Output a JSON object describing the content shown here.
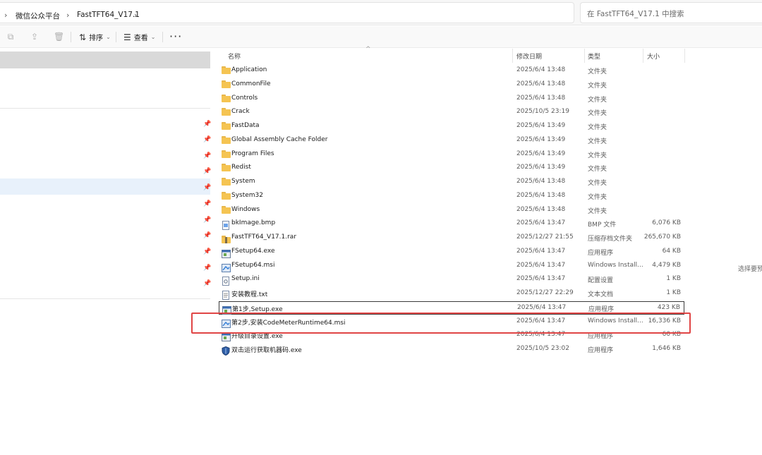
{
  "breadcrumb": [
    "微信公众平台",
    "FastTFT64_V17.1"
  ],
  "search_placeholder": "在 FastTFT64_V17.1 中搜索",
  "toolbar": {
    "sort_label": "排序",
    "view_label": "查看",
    "more_label": "···"
  },
  "columns": {
    "name": "名称",
    "modified": "修改日期",
    "type": "类型",
    "size": "大小"
  },
  "files": [
    {
      "name": "Application",
      "date": "2025/6/4 13:48",
      "type": "文件夹",
      "size": "",
      "icon": "folder-icon"
    },
    {
      "name": "CommonFile",
      "date": "2025/6/4 13:48",
      "type": "文件夹",
      "size": "",
      "icon": "folder-icon"
    },
    {
      "name": "Controls",
      "date": "2025/6/4 13:48",
      "type": "文件夹",
      "size": "",
      "icon": "folder-icon"
    },
    {
      "name": "Crack",
      "date": "2025/10/5 23:19",
      "type": "文件夹",
      "size": "",
      "icon": "folder-icon"
    },
    {
      "name": "FastData",
      "date": "2025/6/4 13:49",
      "type": "文件夹",
      "size": "",
      "icon": "folder-icon"
    },
    {
      "name": "Global Assembly Cache Folder",
      "date": "2025/6/4 13:49",
      "type": "文件夹",
      "size": "",
      "icon": "folder-icon"
    },
    {
      "name": "Program Files",
      "date": "2025/6/4 13:49",
      "type": "文件夹",
      "size": "",
      "icon": "folder-icon"
    },
    {
      "name": "Redist",
      "date": "2025/6/4 13:49",
      "type": "文件夹",
      "size": "",
      "icon": "folder-icon"
    },
    {
      "name": "System",
      "date": "2025/6/4 13:48",
      "type": "文件夹",
      "size": "",
      "icon": "folder-icon"
    },
    {
      "name": "System32",
      "date": "2025/6/4 13:48",
      "type": "文件夹",
      "size": "",
      "icon": "folder-icon"
    },
    {
      "name": "Windows",
      "date": "2025/6/4 13:48",
      "type": "文件夹",
      "size": "",
      "icon": "folder-icon"
    },
    {
      "name": "bkImage.bmp",
      "date": "2025/6/4 13:47",
      "type": "BMP 文件",
      "size": "6,076 KB",
      "icon": "image-file-icon"
    },
    {
      "name": "FastTFT64_V17.1.rar",
      "date": "2025/12/27 21:55",
      "type": "压缩存档文件夹",
      "size": "265,670 KB",
      "icon": "archive-icon"
    },
    {
      "name": "FSetup64.exe",
      "date": "2025/6/4 13:47",
      "type": "应用程序",
      "size": "64 KB",
      "icon": "exe-icon"
    },
    {
      "name": "FSetup64.msi",
      "date": "2025/6/4 13:47",
      "type": "Windows Install...",
      "size": "4,479 KB",
      "icon": "msi-icon"
    },
    {
      "name": "Setup.ini",
      "date": "2025/6/4 13:47",
      "type": "配置设置",
      "size": "1 KB",
      "icon": "ini-icon"
    },
    {
      "name": "安装教程.txt",
      "date": "2025/12/27 22:29",
      "type": "文本文档",
      "size": "1 KB",
      "icon": "text-file-icon"
    },
    {
      "name": "第1步,Setup.exe",
      "date": "2025/6/4 13:47",
      "type": "应用程序",
      "size": "423 KB",
      "icon": "exe-icon"
    },
    {
      "name": "第2步,安装CodeMeterRuntime64.msi",
      "date": "2025/6/4 13:47",
      "type": "Windows Install...",
      "size": "16,336 KB",
      "icon": "msi-icon"
    },
    {
      "name": "升级目录设置.exe",
      "date": "2025/6/4 13:47",
      "type": "应用程序",
      "size": "60 KB",
      "icon": "exe-icon"
    },
    {
      "name": "双击运行获取机器码.exe",
      "date": "2025/10/5 23:02",
      "type": "应用程序",
      "size": "1,646 KB",
      "icon": "shield-exe-icon"
    }
  ],
  "side_hint": "选择要预",
  "colors": {
    "accent": "#e04545",
    "folder": "#f5c452",
    "selection": "#e8f1fb"
  }
}
